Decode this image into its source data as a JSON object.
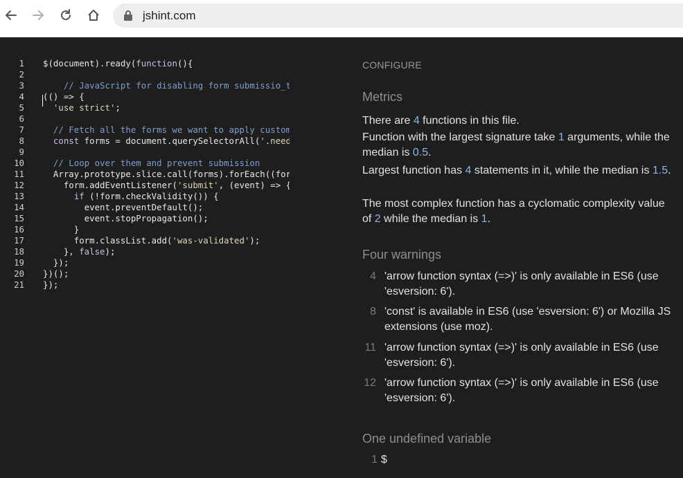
{
  "browser": {
    "url": "jshint.com"
  },
  "editor": {
    "lines": [
      {
        "n": "1",
        "t": [
          {
            "c": "fn",
            "v": "$(document).ready("
          },
          {
            "c": "kw",
            "v": "function"
          },
          {
            "c": "fn",
            "v": "(){"
          }
        ]
      },
      {
        "n": "2",
        "t": []
      },
      {
        "n": "3",
        "t": [
          {
            "c": "com",
            "v": "    // JavaScript for disabling form submissio̲tstrap)"
          }
        ]
      },
      {
        "n": "4",
        "t": [
          {
            "c": "fn",
            "v": "(() => {"
          }
        ]
      },
      {
        "n": "5",
        "t": [
          {
            "c": "str",
            "v": "  'use strict'"
          },
          {
            "c": "fn",
            "v": ";"
          }
        ]
      },
      {
        "n": "6",
        "t": []
      },
      {
        "n": "7",
        "t": [
          {
            "c": "com",
            "v": "  // Fetch all the forms we want to apply custom Bootstrap validation styles to"
          }
        ]
      },
      {
        "n": "8",
        "t": [
          {
            "c": "kw",
            "v": "  const"
          },
          {
            "c": "fn",
            "v": " forms = document.querySelectorAll("
          },
          {
            "c": "str",
            "v": "'.needs-validation'"
          },
          {
            "c": "fn",
            "v": ")"
          }
        ]
      },
      {
        "n": "9",
        "t": []
      },
      {
        "n": "10",
        "t": [
          {
            "c": "com",
            "v": "  // Loop over them and prevent submission"
          }
        ]
      },
      {
        "n": "11",
        "t": [
          {
            "c": "fn",
            "v": "  Array.prototype.slice.call(forms).forEach((form) => {"
          }
        ]
      },
      {
        "n": "12",
        "t": [
          {
            "c": "fn",
            "v": "    form.addEventListener("
          },
          {
            "c": "str",
            "v": "'submit'"
          },
          {
            "c": "fn",
            "v": ", (event) => {"
          }
        ]
      },
      {
        "n": "13",
        "t": [
          {
            "c": "kw",
            "v": "      if"
          },
          {
            "c": "fn",
            "v": " (!form.checkValidity()) {"
          }
        ]
      },
      {
        "n": "14",
        "t": [
          {
            "c": "fn",
            "v": "        event.preventDefault();"
          }
        ]
      },
      {
        "n": "15",
        "t": [
          {
            "c": "fn",
            "v": "        event.stopPropagation();"
          }
        ]
      },
      {
        "n": "16",
        "t": [
          {
            "c": "fn",
            "v": "      }"
          }
        ]
      },
      {
        "n": "17",
        "t": [
          {
            "c": "fn",
            "v": "      form.classList.add("
          },
          {
            "c": "str",
            "v": "'was-validated'"
          },
          {
            "c": "fn",
            "v": ");"
          }
        ]
      },
      {
        "n": "18",
        "t": [
          {
            "c": "fn",
            "v": "    }, "
          },
          {
            "c": "kw",
            "v": "false"
          },
          {
            "c": "fn",
            "v": ");"
          }
        ]
      },
      {
        "n": "19",
        "t": [
          {
            "c": "fn",
            "v": "  });"
          }
        ]
      },
      {
        "n": "20",
        "t": [
          {
            "c": "fn",
            "v": "})();"
          }
        ]
      },
      {
        "n": "21",
        "t": [
          {
            "c": "fn",
            "v": "});"
          }
        ]
      }
    ]
  },
  "report": {
    "configure": "CONFIGURE",
    "metrics_title": "Metrics",
    "metrics": {
      "m1": {
        "a": "There are ",
        "n1": "4",
        "b": " functions in this file."
      },
      "m2": {
        "a": "Function with the largest signature take ",
        "n1": "1",
        "b": " arguments, while the median is ",
        "n2": "0.5",
        "c": "."
      },
      "m3": {
        "a": "Largest function has ",
        "n1": "4",
        "b": " statements in it, while the median is ",
        "n2": "1.5",
        "c": "."
      },
      "m4": {
        "a": "The most complex function has a cyclomatic complexity value of ",
        "n1": "2",
        "b": " while the median is ",
        "n2": "1",
        "c": "."
      }
    },
    "warnings_title": "Four warnings",
    "warnings": [
      {
        "line": "4",
        "text": "'arrow function syntax (=>)' is only available in ES6 (use 'esversion: 6')."
      },
      {
        "line": "8",
        "text": "'const' is available in ES6 (use 'esversion: 6') or Mozilla JS extensions (use moz)."
      },
      {
        "line": "11",
        "text": "'arrow function syntax (=>)' is only available in ES6 (use 'esversion: 6')."
      },
      {
        "line": "12",
        "text": "'arrow function syntax (=>)' is only available in ES6 (use 'esversion: 6')."
      }
    ],
    "undefined_title": "One undefined variable",
    "undefined": [
      {
        "line": "1",
        "name": "$"
      }
    ]
  },
  "colors": {
    "number": "#8fb4e6",
    "editor_bg": "#1e1e1e",
    "comment": "#7f9fd0"
  }
}
